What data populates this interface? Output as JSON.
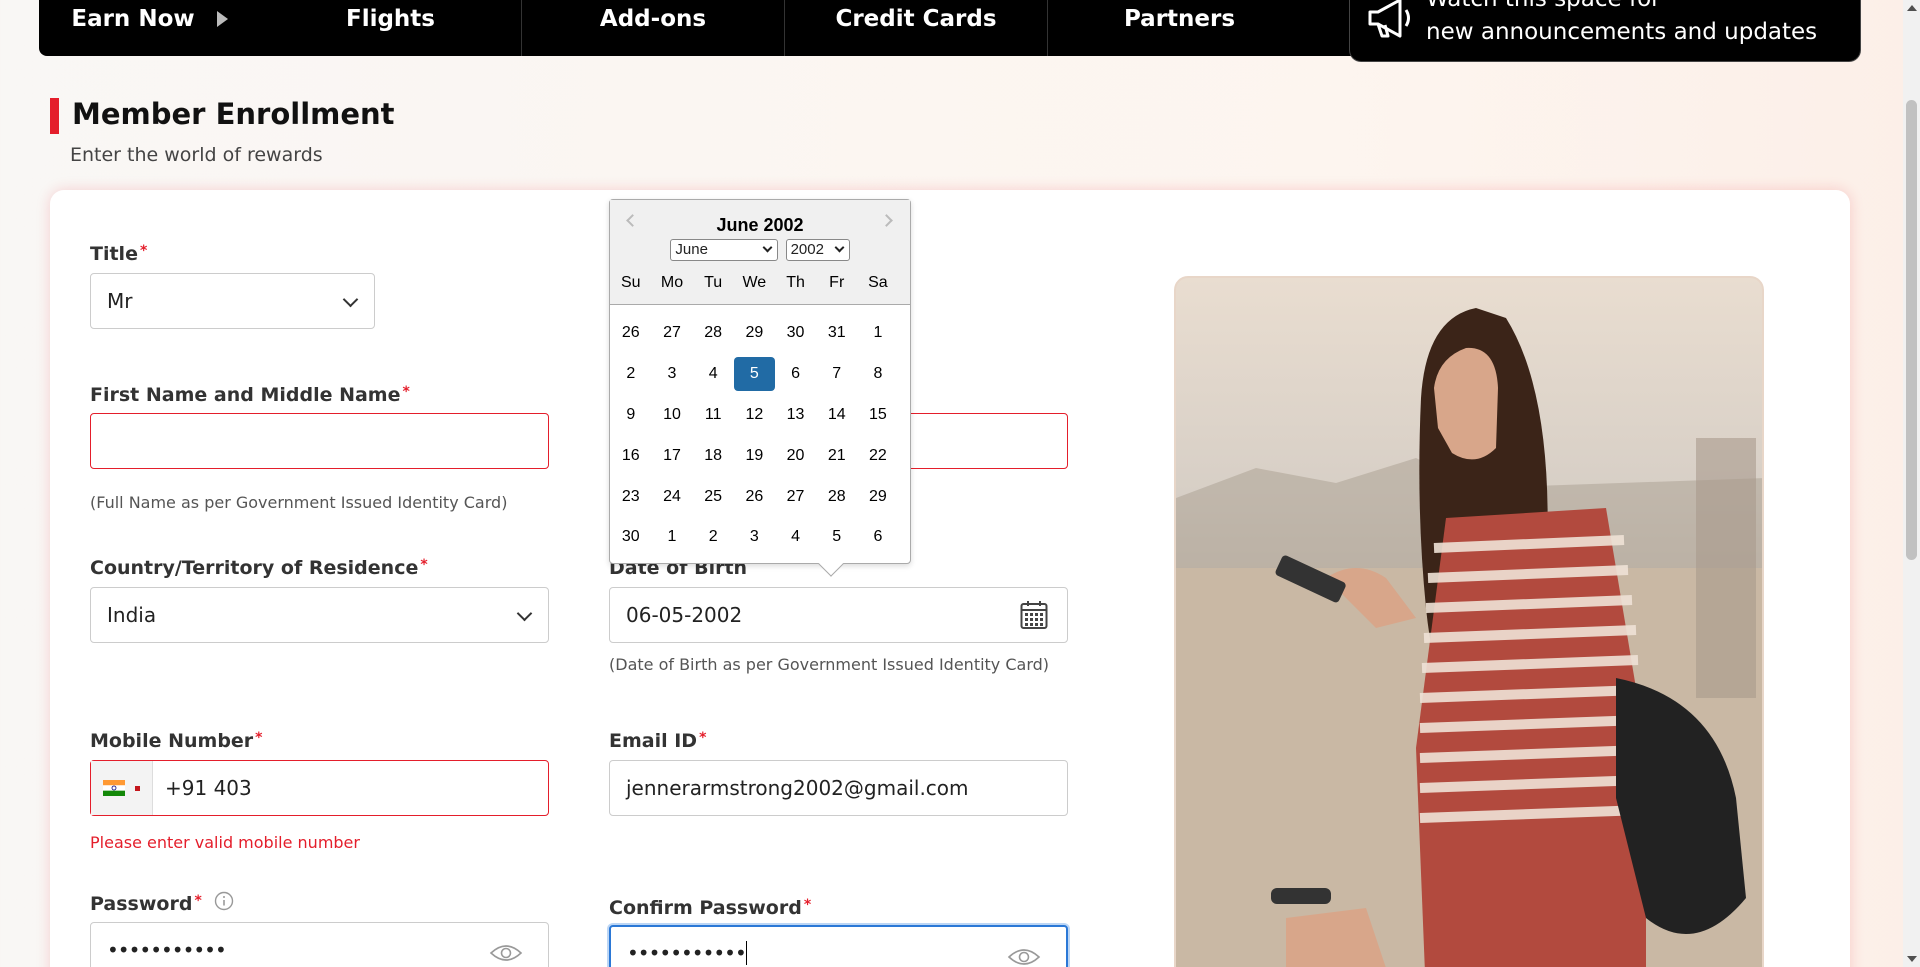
{
  "nav": {
    "items": [
      "Earn Now",
      "Flights",
      "Add-ons",
      "Credit Cards",
      "Partners"
    ],
    "announcement_line1": "Watch this space for",
    "announcement_line2": "new announcements and updates"
  },
  "page": {
    "title": "Member Enrollment",
    "subtitle": "Enter the world of rewards"
  },
  "form": {
    "title_label": "Title",
    "title_value": "Mr",
    "first_name_label": "First Name and Middle Name",
    "first_name_value": "",
    "first_name_hint": "(Full Name as per Government Issued Identity Card)",
    "country_label": "Country/Territory of Residence",
    "country_value": "India",
    "dob_label": "Date of Birth",
    "dob_value": "06-05-2002",
    "dob_hint": "(Date of Birth as per Government Issued Identity Card)",
    "mobile_label": "Mobile Number",
    "mobile_value": "+91 403",
    "mobile_error": "Please enter valid mobile number",
    "email_label": "Email ID",
    "email_value": "jennerarmstrong2002@gmail.com",
    "password_label": "Password",
    "password_value": "•••••••••••",
    "confirm_password_label": "Confirm Password",
    "confirm_password_value": "•••••••••••",
    "required_marker": "*"
  },
  "datepicker": {
    "header": "June 2002",
    "month_select": "June",
    "year_select": "2002",
    "weekdays": [
      "Su",
      "Mo",
      "Tu",
      "We",
      "Th",
      "Fr",
      "Sa"
    ],
    "weeks": [
      [
        "26",
        "27",
        "28",
        "29",
        "30",
        "31",
        "1"
      ],
      [
        "2",
        "3",
        "4",
        "5",
        "6",
        "7",
        "8"
      ],
      [
        "9",
        "10",
        "11",
        "12",
        "13",
        "14",
        "15"
      ],
      [
        "16",
        "17",
        "18",
        "19",
        "20",
        "21",
        "22"
      ],
      [
        "23",
        "24",
        "25",
        "26",
        "27",
        "28",
        "29"
      ],
      [
        "30",
        "1",
        "2",
        "3",
        "4",
        "5",
        "6"
      ]
    ],
    "selected_day": "5"
  },
  "colors": {
    "accent": "#e41e2b",
    "selected_day": "#216ba5",
    "nav_bg": "#000000"
  }
}
